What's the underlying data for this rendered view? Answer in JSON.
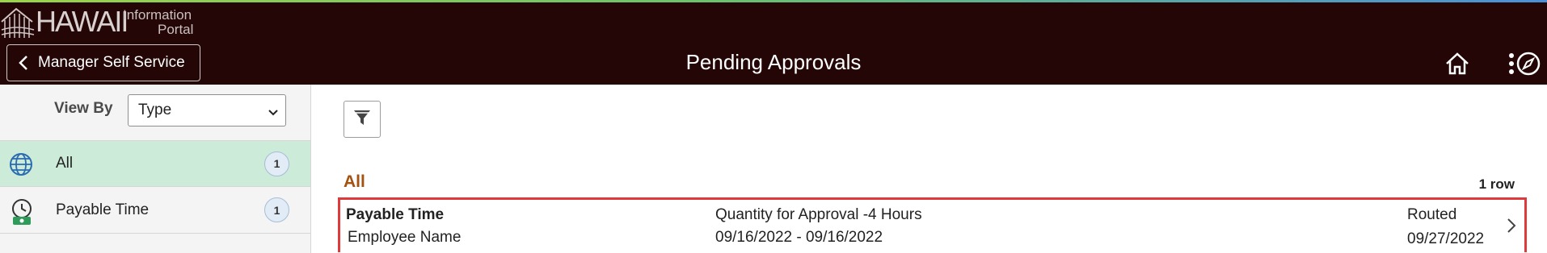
{
  "header": {
    "logo": {
      "name": "HAWAII",
      "line1": "Information",
      "line2": "Portal"
    },
    "back_label": "Manager Self Service",
    "title": "Pending Approvals",
    "icons": [
      "home-icon",
      "more-vertical-icon",
      "navbar-compass-icon"
    ]
  },
  "sidebar": {
    "view_by_label": "View By",
    "view_by_value": "Type",
    "items": [
      {
        "label": "All",
        "count": "1",
        "icon": "globe-icon",
        "active": true
      },
      {
        "label": "Payable Time",
        "count": "1",
        "icon": "time-clock-money-icon",
        "active": false
      }
    ]
  },
  "main": {
    "section_title": "All",
    "row_count": "1 row",
    "rows": [
      {
        "type": "Payable Time",
        "employee": "Employee Name",
        "description": "Quantity for Approval -4 Hours",
        "date_range": "09/16/2022 - 09/16/2022",
        "status": "Routed",
        "status_date": "09/27/2022"
      }
    ]
  },
  "colors": {
    "header_bg": "#250606",
    "active_item_bg": "#cdebd9",
    "section_title": "#a35210",
    "highlight_border": "#e0393b"
  }
}
